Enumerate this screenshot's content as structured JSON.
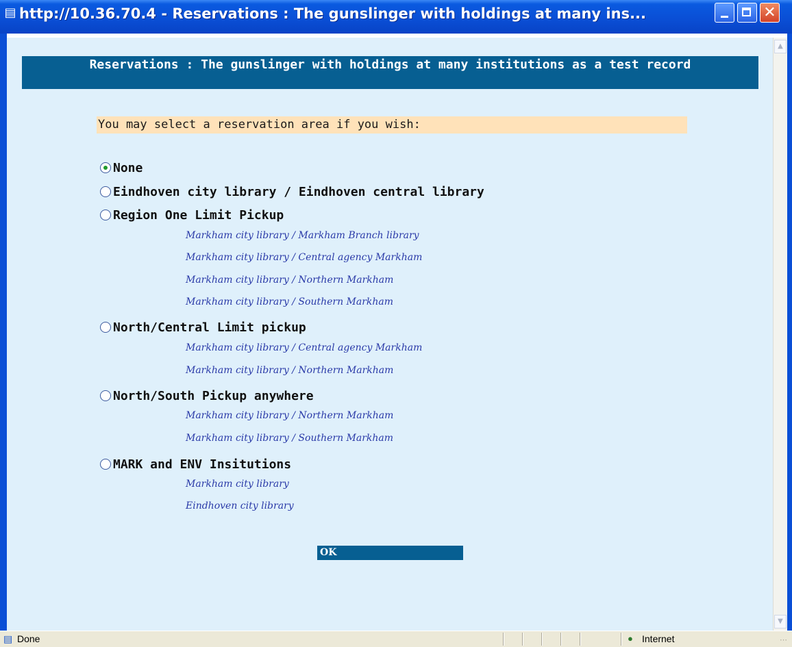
{
  "window": {
    "title": "http://10.36.70.4 - Reservations : The gunslinger with holdings at many ins...",
    "icon": "ie-page-icon",
    "controls": [
      "minimize",
      "maximize",
      "close"
    ]
  },
  "header": {
    "title": "Reservations : The gunslinger with holdings at many institutions as a test record"
  },
  "prompt": "You may select a reservation area if you wish:",
  "options": [
    {
      "label": "None",
      "checked": true,
      "locations": []
    },
    {
      "label": "Eindhoven city library / Eindhoven central library",
      "checked": false,
      "locations": []
    },
    {
      "label": "Region One Limit Pickup",
      "checked": false,
      "locations": [
        "Markham city library / Markham Branch library",
        "Markham city library / Central agency Markham",
        "Markham city library / Northern Markham",
        "Markham city library / Southern Markham"
      ]
    },
    {
      "label": "North/Central Limit pickup",
      "checked": false,
      "locations": [
        "Markham city library / Central agency Markham",
        "Markham city library / Northern Markham"
      ]
    },
    {
      "label": "North/South Pickup anywhere",
      "checked": false,
      "locations": [
        "Markham city library / Northern Markham",
        "Markham city library / Southern Markham"
      ]
    },
    {
      "label": "MARK and ENV Insitutions",
      "checked": false,
      "locations": [
        "Markham city library",
        "Eindhoven city library"
      ]
    }
  ],
  "ok_label": "OK",
  "statusbar": {
    "status": "Done",
    "zone": "Internet"
  },
  "colors": {
    "content_bg": "#dff0fb",
    "header_bg": "#075f92",
    "prompt_bg": "#ffe2b9",
    "location_text": "#2a3aa8"
  }
}
